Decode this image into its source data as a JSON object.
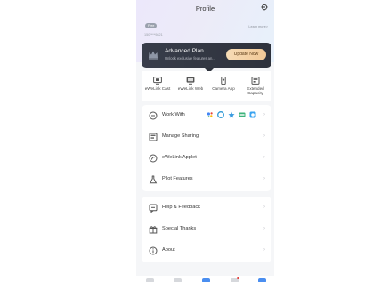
{
  "header": {
    "title": "Profile",
    "vip_badge": "Free",
    "user_id": "150****9821",
    "learn_more": "Learn more>"
  },
  "plan": {
    "name": "Advanced Plan",
    "subtitle": "Unlock exclusive features an...",
    "button": "Update Now",
    "colors": {
      "card": "#2f333d",
      "button": "#f3cfa1"
    }
  },
  "shortcuts": [
    {
      "label": "eWeLink Cast",
      "icon": "cast-icon"
    },
    {
      "label": "eWeLink Web",
      "icon": "monitor-icon"
    },
    {
      "label": "Camera App",
      "icon": "phone-camera-icon"
    },
    {
      "label": "Extended Capacity",
      "icon": "capacity-icon"
    }
  ],
  "menu_main": [
    {
      "label": "Work With",
      "icon": "link-icon"
    },
    {
      "label": "Manage Sharing",
      "icon": "share-icon"
    },
    {
      "label": "eWeLink Applet",
      "icon": "applet-icon"
    },
    {
      "label": "Pilot Features",
      "icon": "flask-icon"
    }
  ],
  "work_with_services": [
    "google-assistant-icon",
    "alexa-icon",
    "smartthings-icon",
    "ifttt-icon",
    "alice-icon"
  ],
  "menu_secondary": [
    {
      "label": "Help & Feedback",
      "icon": "help-icon"
    },
    {
      "label": "Special Thanks",
      "icon": "gift-icon"
    },
    {
      "label": "About",
      "icon": "info-icon"
    }
  ],
  "chevron": "›"
}
